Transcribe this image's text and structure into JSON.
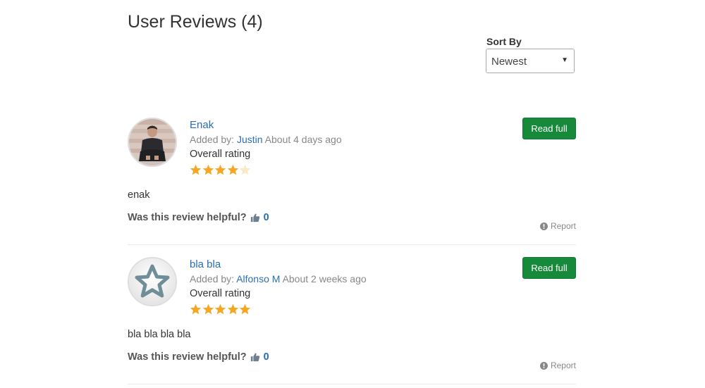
{
  "header": {
    "title": "User Reviews (4)"
  },
  "sort": {
    "label": "Sort By",
    "selected": "Newest"
  },
  "reviews": [
    {
      "title": "Enak",
      "added_by_label": "Added by:",
      "author": "Justin",
      "time": "About 4 days ago",
      "rating_label": "Overall rating",
      "rating": 4,
      "rating_max": 5,
      "read_full_label": "Read full",
      "body": "enak",
      "helpful_label": "Was this review helpful?",
      "helpful_count": "0",
      "report_label": "Report",
      "avatar": "user-photo"
    },
    {
      "title": "bla bla",
      "added_by_label": "Added by:",
      "author": "Alfonso M",
      "time": "About 2 weeks ago",
      "rating_label": "Overall rating",
      "rating": 5,
      "rating_max": 5,
      "read_full_label": "Read full",
      "body": "bla bla bla bla",
      "helpful_label": "Was this review helpful?",
      "helpful_count": "0",
      "report_label": "Report",
      "avatar": "default-star-avatar"
    }
  ],
  "colors": {
    "link": "#2a6fb0",
    "star": "#f5a623",
    "button": "#168a3a"
  }
}
